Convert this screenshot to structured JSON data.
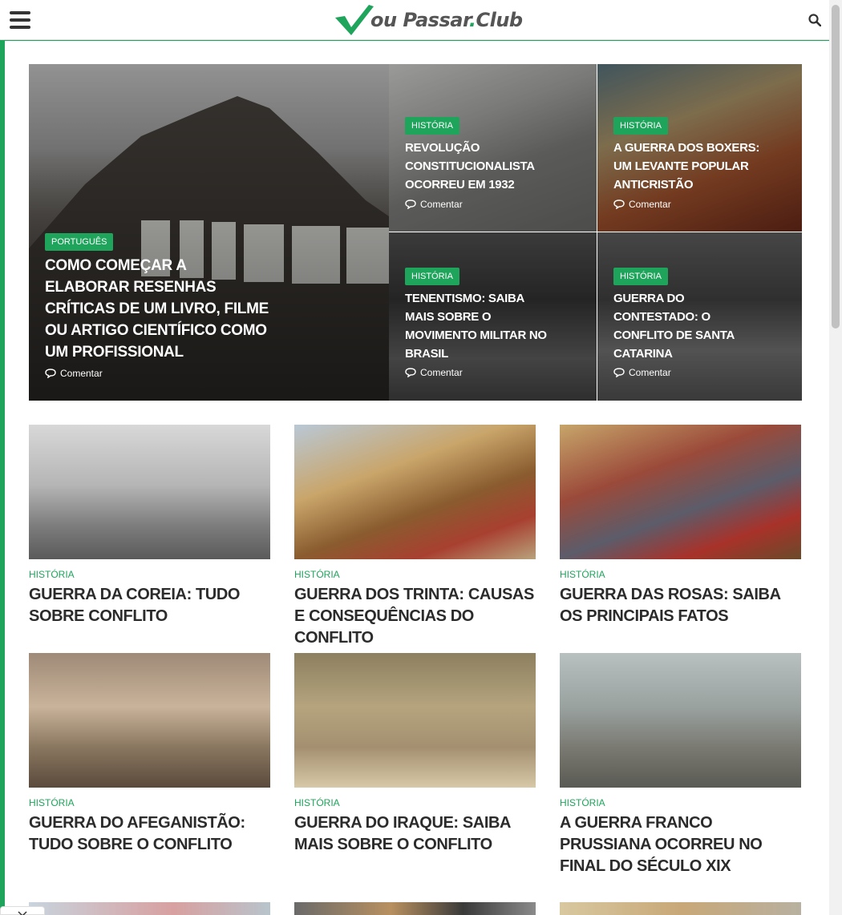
{
  "site": {
    "logo_prefix": "ou Passar",
    "logo_dot": ".",
    "logo_suffix": "Club"
  },
  "icons": {
    "menu": "hamburger-menu-icon",
    "search": "search-icon",
    "comment": "comment-bubble-icon",
    "close": "close-icon"
  },
  "colors": {
    "accent": "#1fa45b",
    "title": "#2b2b2b"
  },
  "hero": {
    "main": {
      "category": "PORTUGUÊS",
      "title": "COMO COMEÇAR A ELABORAR RESENHAS CRÍTICAS DE UM LIVRO, FILME OU ARTIGO CIENTÍFICO COMO UM PROFISSIONAL",
      "comment_label": "Comentar"
    },
    "tiles": [
      {
        "category": "HISTÓRIA",
        "title": "REVOLUÇÃO CONSTITUCIONALISTA OCORREU EM 1932",
        "comment_label": "Comentar"
      },
      {
        "category": "HISTÓRIA",
        "title": "A GUERRA DOS BOXERS: UM LEVANTE POPULAR ANTICRISTÃO",
        "comment_label": "Comentar"
      },
      {
        "category": "HISTÓRIA",
        "title": "TENENTISMO: SAIBA MAIS SOBRE O MOVIMENTO MILITAR NO BRASIL",
        "comment_label": "Comentar"
      },
      {
        "category": "HISTÓRIA",
        "title": "GUERRA DO CONTESTADO: O CONFLITO DE SANTA CATARINA",
        "comment_label": "Comentar"
      }
    ]
  },
  "posts": [
    {
      "category": "HISTÓRIA",
      "title": "GUERRA DA COREIA: TUDO SOBRE CONFLITO"
    },
    {
      "category": "HISTÓRIA",
      "title": "GUERRA DOS TRINTA: CAUSAS E CONSEQUÊNCIAS DO CONFLITO"
    },
    {
      "category": "HISTÓRIA",
      "title": "GUERRA DAS ROSAS: SAIBA OS PRINCIPAIS FATOS"
    },
    {
      "category": "HISTÓRIA",
      "title": "GUERRA DO AFEGANISTÃO: TUDO SOBRE O CONFLITO"
    },
    {
      "category": "HISTÓRIA",
      "title": "GUERRA DO IRAQUE: SAIBA MAIS SOBRE O CONFLITO"
    },
    {
      "category": "HISTÓRIA",
      "title": "A GUERRA FRANCO PRUSSIANA OCORREU NO FINAL DO SÉCULO XIX"
    }
  ]
}
